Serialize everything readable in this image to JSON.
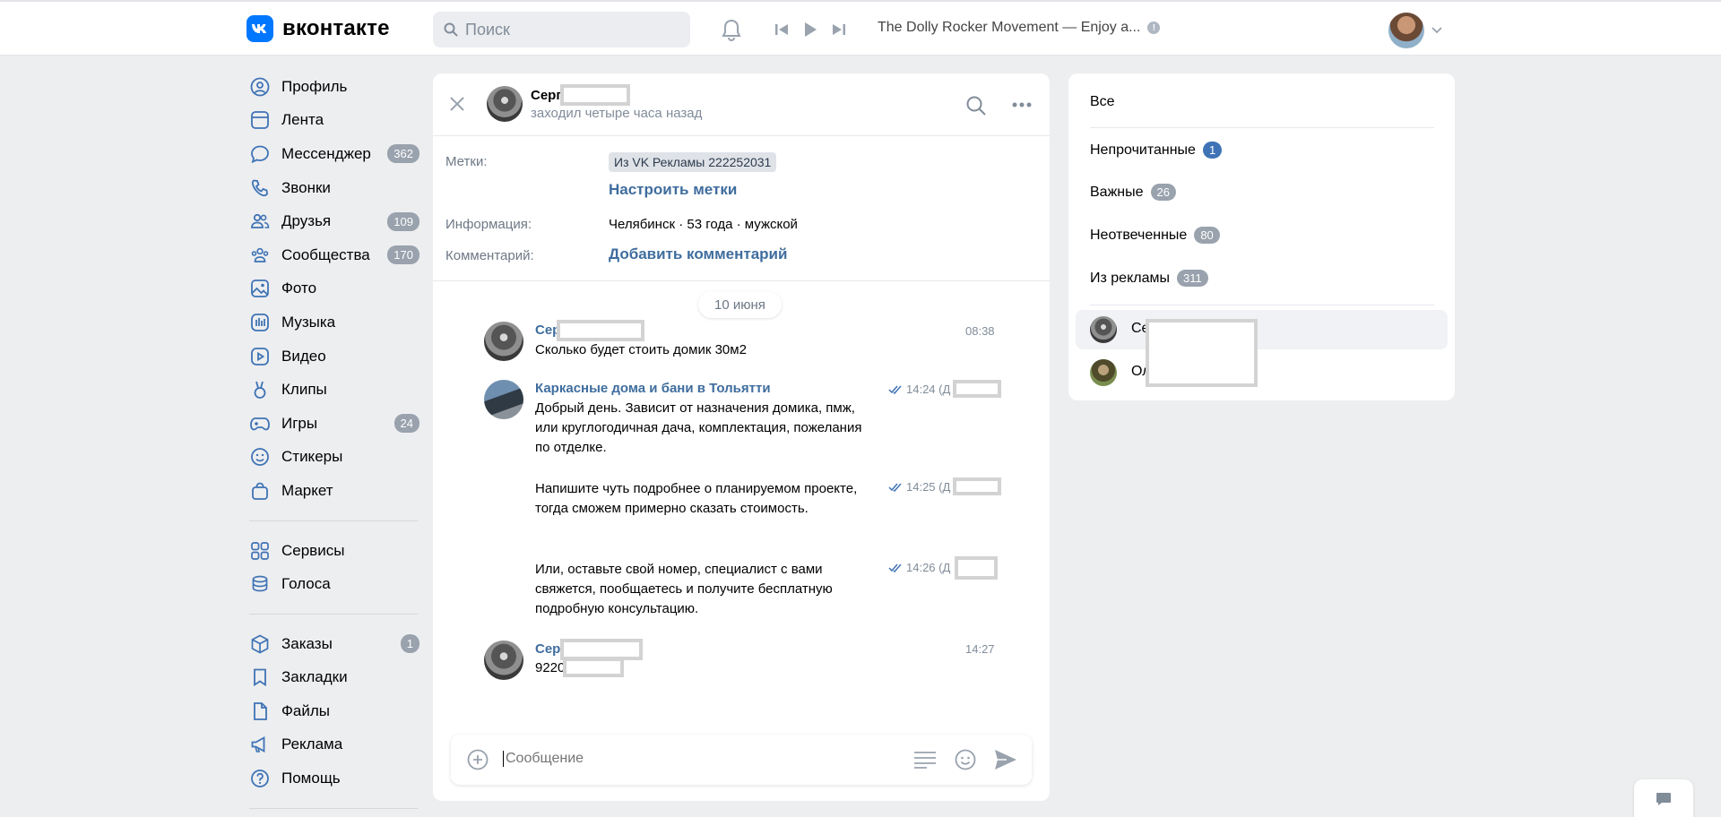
{
  "header": {
    "logo_text": "вконтакте",
    "search_placeholder": "Поиск",
    "track": "The Dolly Rocker Movement — Enjoy a..."
  },
  "sidebar": {
    "items": [
      {
        "label": "Профиль",
        "icon": "profile-icon"
      },
      {
        "label": "Лента",
        "icon": "feed-icon"
      },
      {
        "label": "Мессенджер",
        "icon": "messenger-icon",
        "badge": "362"
      },
      {
        "label": "Звонки",
        "icon": "phone-icon"
      },
      {
        "label": "Друзья",
        "icon": "friends-icon",
        "badge": "109"
      },
      {
        "label": "Сообщества",
        "icon": "communities-icon",
        "badge": "170"
      },
      {
        "label": "Фото",
        "icon": "photo-icon"
      },
      {
        "label": "Музыка",
        "icon": "music-icon"
      },
      {
        "label": "Видео",
        "icon": "video-icon"
      },
      {
        "label": "Клипы",
        "icon": "clips-icon"
      },
      {
        "label": "Игры",
        "icon": "games-icon",
        "badge": "24"
      },
      {
        "label": "Стикеры",
        "icon": "stickers-icon"
      },
      {
        "label": "Маркет",
        "icon": "market-icon"
      }
    ],
    "items2": [
      {
        "label": "Сервисы",
        "icon": "services-icon"
      },
      {
        "label": "Голоса",
        "icon": "votes-icon"
      }
    ],
    "items3": [
      {
        "label": "Заказы",
        "icon": "orders-icon",
        "badge": "1"
      },
      {
        "label": "Закладки",
        "icon": "bookmarks-icon"
      },
      {
        "label": "Файлы",
        "icon": "files-icon"
      },
      {
        "label": "Реклама",
        "icon": "ads-icon"
      },
      {
        "label": "Помощь",
        "icon": "help-icon"
      }
    ]
  },
  "chat": {
    "name": "Серг",
    "status": "заходил четыре часа назад",
    "labels_key": "Метки:",
    "tag": "Из VK Рекламы 222252031",
    "configure_labels": "Настроить метки",
    "info_key": "Информация:",
    "info_value": "Челябинск · 53 года · мужской",
    "comment_key": "Комментарий:",
    "add_comment": "Добавить комментарий",
    "date": "10 июня",
    "messages": [
      {
        "author": "Сер",
        "time": "08:38",
        "text": "Сколько будет стоить домик 30м2"
      },
      {
        "author": "Каркасные дома и бани в Тольятти",
        "time": "14:24 (Д",
        "text": "Добрый день. Зависит от назначения домика, пмж, или круглогодичная дача, комплектация, пожелания по отделке."
      },
      {
        "time": "14:25 (Д",
        "text": "Напишите чуть подробнее о планируемом проекте, тогда сможем примерно сказать стоимость."
      },
      {
        "time": "14:26 (Д",
        "text": "Или, оставьте свой номер, специалист с вами свяжется, пообщаетесь и получите бесплатную подробную консультацию."
      },
      {
        "author": "Серг",
        "time": "14:27",
        "text": "9220"
      }
    ],
    "composer_placeholder": "Сообщение"
  },
  "filters": {
    "all": "Все",
    "unread": "Непрочитанные",
    "unread_count": "1",
    "important": "Важные",
    "important_count": "26",
    "unanswered": "Неотвеченные",
    "unanswered_count": "80",
    "from_ads": "Из рекламы",
    "from_ads_count": "311",
    "chats": [
      {
        "name": "Се"
      },
      {
        "name": "Ол"
      }
    ]
  }
}
